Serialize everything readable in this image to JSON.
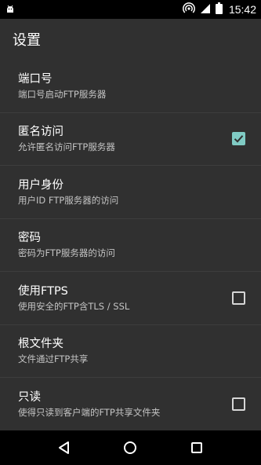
{
  "status_bar": {
    "time": "15:42",
    "icons": [
      "android-debug-icon",
      "hotspot-icon",
      "signal-icon",
      "battery-icon"
    ]
  },
  "app": {
    "title": "设置"
  },
  "preferences": [
    {
      "title": "端口号",
      "summary": "端口号启动FTP服务器",
      "control": "none"
    },
    {
      "title": "匿名访问",
      "summary": "允许匿名访问FTP服务器",
      "control": "checkbox",
      "checked": true
    },
    {
      "title": "用户身份",
      "summary": "用户ID FTP服务器的访问",
      "control": "none"
    },
    {
      "title": "密码",
      "summary": "密码为FTP服务器的访问",
      "control": "none"
    },
    {
      "title": "使用FTPS",
      "summary": "使用安全的FTP含TLS / SSL",
      "control": "checkbox",
      "checked": false
    },
    {
      "title": "根文件夹",
      "summary": "文件通过FTP共享",
      "control": "none"
    },
    {
      "title": "只读",
      "summary": "使得只读到客户端的FTP共享文件夹",
      "control": "checkbox",
      "checked": false
    }
  ],
  "colors": {
    "accent": "#80cbc4",
    "background": "#303030"
  },
  "nav_bar": {
    "icons": [
      "back-icon",
      "home-icon",
      "recents-icon"
    ]
  }
}
